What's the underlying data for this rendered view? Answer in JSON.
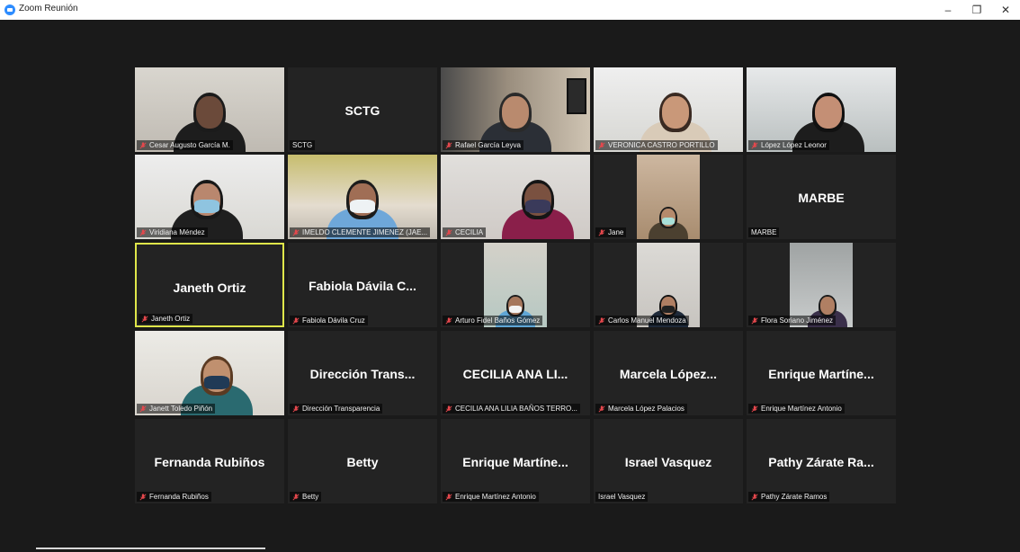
{
  "window": {
    "title": "Zoom Reunión",
    "controls": {
      "minimize": "–",
      "restore": "❐",
      "close": "✕"
    }
  },
  "colors": {
    "active_speaker": "#dfe64a",
    "muted_icon": "#e5484d"
  },
  "participants": [
    {
      "label": "Cesar Augusto García M.",
      "muted": true,
      "video": true
    },
    {
      "name": "SCTG",
      "label": "SCTG",
      "muted": false,
      "video": false
    },
    {
      "label": "Rafael García Leyva",
      "muted": true,
      "video": true
    },
    {
      "label": "VERONICA CASTRO PORTILLO",
      "muted": true,
      "video": true
    },
    {
      "label": "López López Leonor",
      "muted": true,
      "video": true
    },
    {
      "label": "Viridiana Méndez",
      "muted": true,
      "video": true
    },
    {
      "label": "IMELDO CLEMENTE JIMENEZ (JAE...",
      "muted": true,
      "video": true
    },
    {
      "label": "CECILIA",
      "muted": true,
      "video": true
    },
    {
      "label": "Jane",
      "muted": true,
      "video": true
    },
    {
      "name": "MARBE",
      "label": "MARBE",
      "muted": false,
      "video": false
    },
    {
      "name": "Janeth Ortiz",
      "label": "Janeth Ortiz",
      "muted": true,
      "video": false,
      "active": true
    },
    {
      "name": "Fabiola Dávila C...",
      "label": "Fabiola Dávila Cruz",
      "muted": true,
      "video": false
    },
    {
      "label": "Arturo Fidel Baños Gómez",
      "muted": true,
      "video": true
    },
    {
      "label": "Carlos Manuel Mendoza",
      "muted": true,
      "video": true
    },
    {
      "label": "Flora Soriano Jiménez",
      "muted": true,
      "video": true
    },
    {
      "label": "Janett Toledo Piñón",
      "muted": true,
      "video": true
    },
    {
      "name": "Dirección Trans...",
      "label": "Dirección Transparencia",
      "muted": true,
      "video": false
    },
    {
      "name": "CECILIA ANA LI...",
      "label": "CECILIA ANA LILIA BAÑOS TERRO...",
      "muted": true,
      "video": false
    },
    {
      "name": "Marcela López...",
      "label": "Marcela López Palacios",
      "muted": true,
      "video": false
    },
    {
      "name": "Enrique Martíne...",
      "label": "Enrique Martínez Antonio",
      "muted": true,
      "video": false
    },
    {
      "name": "Fernanda Rubiños",
      "label": "Fernanda Rubiños",
      "muted": true,
      "video": false
    },
    {
      "name": "Betty",
      "label": "Betty",
      "muted": true,
      "video": false
    },
    {
      "name": "Enrique Martíne...",
      "label": "Enrique Martínez Antonio",
      "muted": true,
      "video": false
    },
    {
      "name": "Israel Vasquez",
      "label": "Israel Vasquez",
      "muted": false,
      "video": false
    },
    {
      "name": "Pathy Zárate Ra...",
      "label": "Pathy Zárate Ramos",
      "muted": true,
      "video": false
    }
  ]
}
